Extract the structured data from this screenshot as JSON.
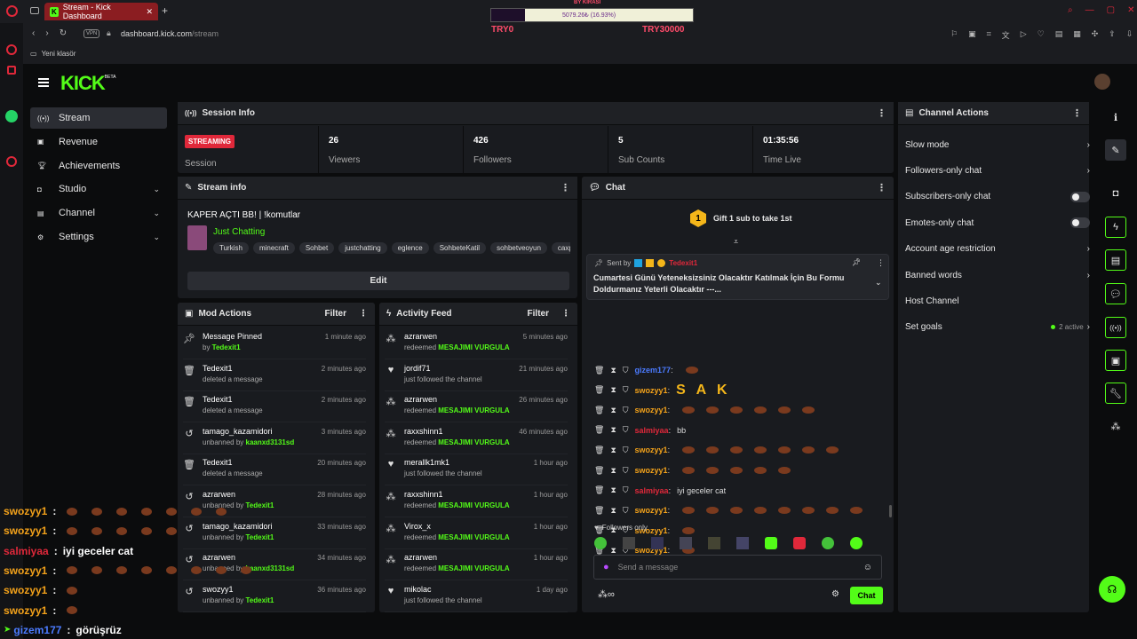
{
  "browser": {
    "tab_title": "Stream - Kick Dashboard",
    "url_domain": "dashboard.kick.com",
    "url_path": "/stream",
    "bookmark": "Yeni klasör",
    "vpn": "VPN"
  },
  "donation_widget": {
    "top_label": "BY KIRASI",
    "amount": "5079.26₺ (16.93%)",
    "progress": 0.1693,
    "left_label": "TRY0",
    "right_label": "TRY30000"
  },
  "logo": {
    "text": "KICK",
    "beta": "BETA"
  },
  "nav": [
    {
      "label": "Stream",
      "icon": "broadcast-icon",
      "active": true
    },
    {
      "label": "Revenue",
      "icon": "revenue-icon"
    },
    {
      "label": "Achievements",
      "icon": "trophy-icon"
    },
    {
      "label": "Studio",
      "icon": "studio-icon",
      "expandable": true
    },
    {
      "label": "Channel",
      "icon": "channel-icon",
      "expandable": true
    },
    {
      "label": "Settings",
      "icon": "gear-icon",
      "expandable": true
    }
  ],
  "session": {
    "title": "Session Info",
    "status": "STREAMING",
    "status_label": "Session",
    "stats": [
      {
        "value": "26",
        "label": "Viewers"
      },
      {
        "value": "426",
        "label": "Followers"
      },
      {
        "value": "5",
        "label": "Sub Counts"
      },
      {
        "value": "01:35:56",
        "label": "Time Live"
      }
    ]
  },
  "stream_info": {
    "title": "Stream info",
    "stream_title": "KAPER AÇTI BB! | !komutlar",
    "category": "Just Chatting",
    "tags": [
      "Turkish",
      "minecraft",
      "Sohbet",
      "justchatting",
      "eglence",
      "SohbeteKatil",
      "sohbetveoyun",
      "caxp"
    ],
    "edit": "Edit"
  },
  "mod_actions": {
    "title": "Mod Actions",
    "filter": "Filter",
    "items": [
      {
        "icon": "pin-icon",
        "title": "Message Pinned",
        "pre": "by ",
        "user": "Tedexit1",
        "post": "",
        "time": "1 minute ago"
      },
      {
        "icon": "trash-icon",
        "title": "Tedexit1",
        "pre": "deleted a message",
        "user": "",
        "post": "",
        "time": "2 minutes ago"
      },
      {
        "icon": "trash-icon",
        "title": "Tedexit1",
        "pre": "deleted a message",
        "user": "",
        "post": "",
        "time": "2 minutes ago"
      },
      {
        "icon": "undo-icon",
        "title": "tamago_kazamidori",
        "pre": "unbanned by ",
        "user": "kaanxd3131sd",
        "post": "",
        "time": "3 minutes ago"
      },
      {
        "icon": "trash-icon",
        "title": "Tedexit1",
        "pre": "deleted a message",
        "user": "",
        "post": "",
        "time": "20 minutes ago"
      },
      {
        "icon": "undo-icon",
        "title": "azrarwen",
        "pre": "unbanned by ",
        "user": "Tedexit1",
        "post": "",
        "time": "28 minutes ago"
      },
      {
        "icon": "undo-icon",
        "title": "tamago_kazamidori",
        "pre": "unbanned by ",
        "user": "Tedexit1",
        "post": "",
        "time": "33 minutes ago"
      },
      {
        "icon": "undo-icon",
        "title": "azrarwen",
        "pre": "unbanned by ",
        "user": "kaanxd3131sd",
        "post": "",
        "time": "34 minutes ago"
      },
      {
        "icon": "undo-icon",
        "title": "swozyy1",
        "pre": "unbanned by ",
        "user": "Tedexit1",
        "post": "",
        "time": "36 minutes ago"
      }
    ]
  },
  "activity": {
    "title": "Activity Feed",
    "filter": "Filter",
    "items": [
      {
        "icon": "points-icon",
        "title": "azrarwen",
        "pre": "redeemed ",
        "user": "MESAJIMI VURGULA",
        "time": "5 minutes ago"
      },
      {
        "icon": "heart-icon",
        "title": "jordif71",
        "pre": "just followed the channel",
        "user": "",
        "time": "21 minutes ago"
      },
      {
        "icon": "points-icon",
        "title": "azrarwen",
        "pre": "redeemed ",
        "user": "MESAJIMI VURGULA",
        "time": "26 minutes ago"
      },
      {
        "icon": "points-icon",
        "title": "raxxshinn1",
        "pre": "redeemed ",
        "user": "MESAJIMI VURGULA",
        "time": "46 minutes ago"
      },
      {
        "icon": "heart-icon",
        "title": "merallk1mk1",
        "pre": "just followed the channel",
        "user": "",
        "time": "1 hour ago"
      },
      {
        "icon": "points-icon",
        "title": "raxxshinn1",
        "pre": "redeemed ",
        "user": "MESAJIMI VURGULA",
        "time": "1 hour ago"
      },
      {
        "icon": "points-icon",
        "title": "Virox_x",
        "pre": "redeemed ",
        "user": "MESAJIMI VURGULA",
        "time": "1 hour ago"
      },
      {
        "icon": "points-icon",
        "title": "azrarwen",
        "pre": "redeemed ",
        "user": "MESAJIMI VURGULA",
        "time": "1 hour ago"
      },
      {
        "icon": "heart-icon",
        "title": "mikolac",
        "pre": "just followed the channel",
        "user": "",
        "time": "1 day ago"
      }
    ]
  },
  "chat": {
    "title": "Chat",
    "gift_rank": "1",
    "gift_text": "Gift 1 sub to take 1st",
    "pinned": {
      "sent_by": "Sent by",
      "user": "Tedexit1",
      "text": "Cumartesi Günü Yeteneksizsiniz Olacaktır Katılmak İçin Bu Formu Doldurmanız Yeterli Olacaktır ---..."
    },
    "messages": [
      {
        "user": "gizem177",
        "color": "#4b7bff",
        "text": "",
        "emotes": 1
      },
      {
        "user": "swozyy1",
        "color": "#f4a21a",
        "text": "S A K",
        "emotes": 0
      },
      {
        "user": "swozyy1",
        "color": "#f4a21a",
        "text": "",
        "emotes": 6
      },
      {
        "user": "salmiyaa",
        "color": "#e0283a",
        "text": "bb",
        "emotes": 0
      },
      {
        "user": "swozyy1",
        "color": "#f4a21a",
        "text": "",
        "emotes": 7
      },
      {
        "user": "swozyy1",
        "color": "#f4a21a",
        "text": "",
        "emotes": 5
      },
      {
        "user": "salmiyaa",
        "color": "#e0283a",
        "text": "iyi geceler cat",
        "emotes": 0
      },
      {
        "user": "swozyy1",
        "color": "#f4a21a",
        "text": "",
        "emotes": 8
      },
      {
        "user": "swozyy1",
        "color": "#f4a21a",
        "text": "",
        "emotes": 1
      },
      {
        "user": "swozyy1",
        "color": "#f4a21a",
        "text": "",
        "emotes": 1
      },
      {
        "user": "gizem177",
        "color": "#4b7bff",
        "text": "görüşrüz",
        "emotes": 0
      }
    ],
    "followers_only": "Followers only",
    "placeholder": "Send a message",
    "send": "Chat"
  },
  "channel_actions": {
    "title": "Channel Actions",
    "items": [
      {
        "label": "Slow mode",
        "type": "chevron"
      },
      {
        "label": "Followers-only chat",
        "type": "chevron"
      },
      {
        "label": "Subscribers-only chat",
        "type": "toggle"
      },
      {
        "label": "Emotes-only chat",
        "type": "toggle"
      },
      {
        "label": "Account age restriction",
        "type": "chevron"
      },
      {
        "label": "Banned words",
        "type": "chevron"
      },
      {
        "label": "Host Channel",
        "type": "none"
      },
      {
        "label": "Set goals",
        "type": "chevron",
        "badge": "2 active"
      }
    ]
  },
  "overlay_chat": [
    {
      "user": "swozyy1",
      "color": "#f4a21a",
      "text": "",
      "emotes": 7
    },
    {
      "user": "swozyy1",
      "color": "#f4a21a",
      "text": "",
      "emotes": 5
    },
    {
      "user": "salmiyaa",
      "color": "#e0283a",
      "text": "iyi geceler cat",
      "emotes": 0
    },
    {
      "user": "swozyy1",
      "color": "#f4a21a",
      "text": "",
      "emotes": 8
    },
    {
      "user": "swozyy1",
      "color": "#f4a21a",
      "text": "",
      "emotes": 1
    },
    {
      "user": "swozyy1",
      "color": "#f4a21a",
      "text": "",
      "emotes": 1
    },
    {
      "user": "gizem177",
      "color": "#4b7bff",
      "text": "görüşrüz",
      "emotes": 0
    }
  ],
  "colors": {
    "accent": "#53fc18",
    "streaming": "#e0283a",
    "panel": "#191b1f",
    "bg": "#0b0c0d"
  }
}
